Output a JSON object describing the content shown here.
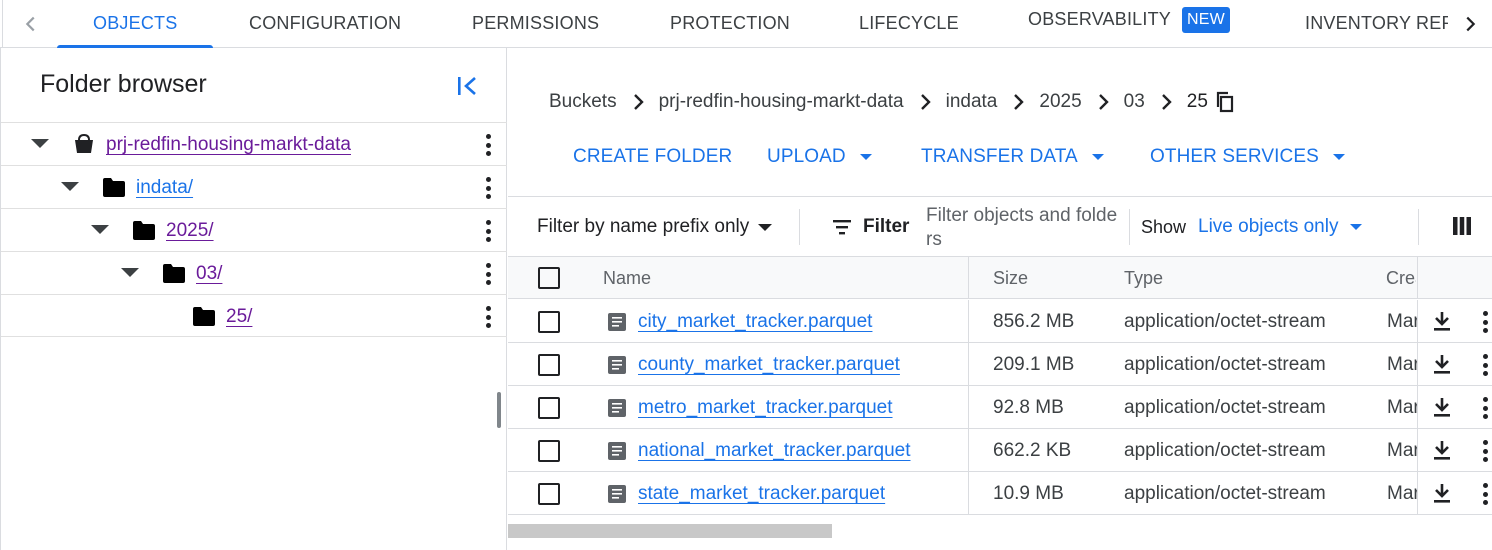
{
  "tabs": [
    {
      "label": "OBJECTS",
      "active": true
    },
    {
      "label": "CONFIGURATION"
    },
    {
      "label": "PERMISSIONS"
    },
    {
      "label": "PROTECTION"
    },
    {
      "label": "LIFECYCLE"
    },
    {
      "label": "OBSERVABILITY",
      "badge": "NEW"
    },
    {
      "label": "INVENTORY REPORTS"
    }
  ],
  "folder_browser": {
    "title": "Folder browser",
    "tree": [
      {
        "label": "prj-redfin-housing-markt-data",
        "icon": "bucket-icon"
      },
      {
        "label": "indata/",
        "icon": "folder-icon"
      },
      {
        "label": "2025/",
        "icon": "folder-icon"
      },
      {
        "label": "03/",
        "icon": "folder-icon"
      },
      {
        "label": "25/",
        "icon": "folder-icon"
      }
    ]
  },
  "breadcrumb": [
    "Buckets",
    "prj-redfin-housing-markt-data",
    "indata",
    "2025",
    "03",
    "25"
  ],
  "actions": {
    "create_folder": "CREATE FOLDER",
    "upload": "UPLOAD",
    "transfer_data": "TRANSFER DATA",
    "other_services": "OTHER SERVICES"
  },
  "filter": {
    "mode": "Filter by name prefix only",
    "button": "Filter",
    "placeholder": "Filter objects and folders",
    "show_label": "Show",
    "show_value": "Live objects only"
  },
  "table": {
    "columns": {
      "name": "Name",
      "size": "Size",
      "type": "Type",
      "created": "Created"
    },
    "rows": [
      {
        "name": "city_market_tracker.parquet",
        "size": "856.2 MB",
        "type": "application/octet-stream",
        "created": "Mar"
      },
      {
        "name": "county_market_tracker.parquet",
        "size": "209.1 MB",
        "type": "application/octet-stream",
        "created": "Mar"
      },
      {
        "name": "metro_market_tracker.parquet",
        "size": "92.8 MB",
        "type": "application/octet-stream",
        "created": "Mar"
      },
      {
        "name": "national_market_tracker.parquet",
        "size": "662.2 KB",
        "type": "application/octet-stream",
        "created": "Mar"
      },
      {
        "name": "state_market_tracker.parquet",
        "size": "10.9 MB",
        "type": "application/octet-stream",
        "created": "Mar"
      }
    ]
  },
  "colors": {
    "accent": "#1a73e8",
    "visited_link": "#6a1b9a",
    "border": "#dadce0"
  }
}
